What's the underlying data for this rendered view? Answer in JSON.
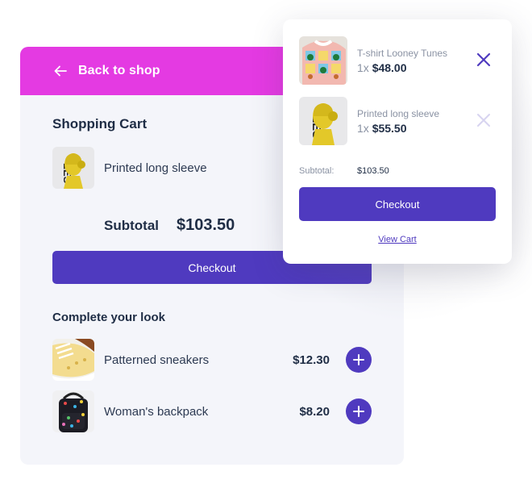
{
  "header": {
    "back_label": "Back to shop",
    "back_icon": "arrow-left-icon",
    "color": "#e43ae2"
  },
  "cart": {
    "title": "Shopping Cart",
    "items": [
      {
        "name": "Printed long sleeve",
        "quantity": "1",
        "image": "statue-print-shirt"
      }
    ],
    "subtotal_label": "Subtotal",
    "subtotal_value": "$103.50",
    "checkout_label": "Checkout"
  },
  "recommendations": {
    "title": "Complete your look",
    "items": [
      {
        "name": "Patterned sneakers",
        "price": "$12.30",
        "image": "banana-sneakers",
        "add_icon": "plus-icon"
      },
      {
        "name": "Woman's backpack",
        "price": "$8.20",
        "image": "printed-backpack",
        "add_icon": "plus-icon"
      }
    ]
  },
  "mini_cart": {
    "items": [
      {
        "name": "T-shirt Looney Tunes",
        "quantity": "1x",
        "price": "$48.00",
        "remove_icon": "close-icon",
        "remove_active": true
      },
      {
        "name": "Printed long sleeve",
        "quantity": "1x",
        "price": "$55.50",
        "remove_icon": "close-icon",
        "remove_active": false
      }
    ],
    "subtotal_label": "Subtotal:",
    "subtotal_value": "$103.50",
    "checkout_label": "Checkout",
    "view_cart_label": "View Cart"
  },
  "colors": {
    "accent": "#4f3abf",
    "header": "#e43ae2",
    "panel_bg": "#f4f5fa",
    "text_dark": "#1f2d45",
    "text_muted": "#8a92a3"
  }
}
